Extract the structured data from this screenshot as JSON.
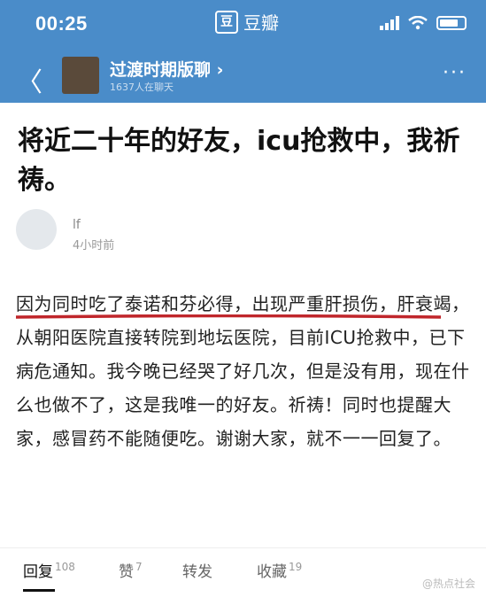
{
  "status_bar": {
    "time": "00:25",
    "app_logo": "豆",
    "app_name": "豆瓣"
  },
  "nav": {
    "back_glyph": "〈",
    "group_name": "过渡时期版聊",
    "group_arrow": "›",
    "group_sub": "1637人在聊天",
    "more_glyph": "···"
  },
  "post": {
    "title": "将近二十年的好友，icu抢救中，我祈祷。",
    "author": {
      "name": "lf",
      "time": "4小时前"
    },
    "content": "因为同时吃了泰诺和芬必得，出现严重肝损伤，肝衰竭，从朝阳医院直接转院到地坛医院，目前ICU抢救中，已下病危通知。我今晚已经哭了好几次，但是没有用，现在什么也做不了，这是我唯一的好友。祈祷！同时也提醒大家，感冒药不能随便吃。谢谢大家，就不一一回复了。"
  },
  "tabs": [
    {
      "label": "回复",
      "count": "108"
    },
    {
      "label": "赞",
      "count": "7"
    },
    {
      "label": "转发",
      "count": ""
    },
    {
      "label": "收藏",
      "count": "19"
    }
  ],
  "watermark": "@热点社会",
  "colors": {
    "header": "#4a8cc9",
    "underline": "#c0262b"
  }
}
